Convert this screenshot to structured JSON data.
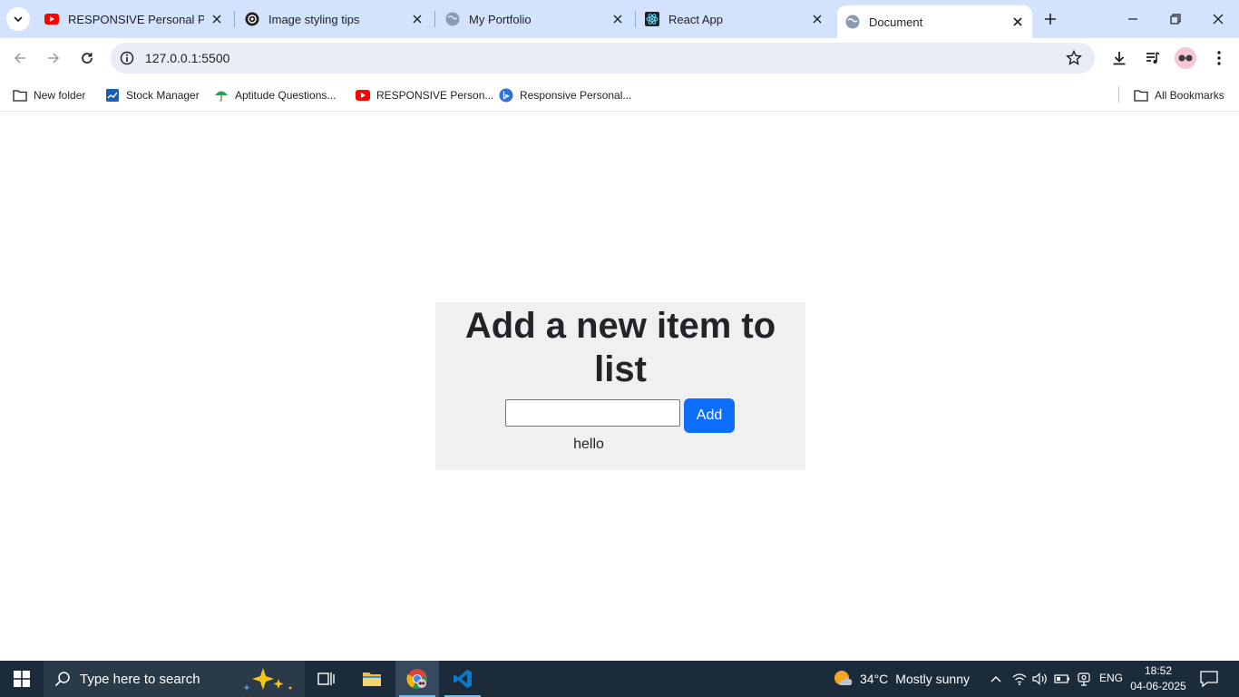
{
  "browser": {
    "tabs": [
      {
        "title": "RESPONSIVE Personal PORT",
        "favicon": "youtube-icon",
        "active": false
      },
      {
        "title": "Image styling tips",
        "favicon": "openai-icon",
        "active": false
      },
      {
        "title": "My Portfolio",
        "favicon": "globe-icon",
        "active": false
      },
      {
        "title": "React App",
        "favicon": "react-icon",
        "active": false
      },
      {
        "title": "Document",
        "favicon": "globe-icon",
        "active": true
      }
    ],
    "address": {
      "url": "127.0.0.1:5500"
    },
    "bookmarks": [
      {
        "label": "New folder",
        "icon": "folder-icon"
      },
      {
        "label": "Stock Manager",
        "icon": "chart-icon"
      },
      {
        "label": "Aptitude Questions...",
        "icon": "umbrella-icon"
      },
      {
        "label": "RESPONSIVE Person...",
        "icon": "youtube-icon"
      },
      {
        "label": "Responsive Personal...",
        "icon": "bing-icon"
      }
    ],
    "all_bookmarks": "All Bookmarks"
  },
  "page": {
    "heading": "Add a new item to list",
    "input_value": "",
    "add_button": "Add",
    "items": [
      "hello"
    ]
  },
  "taskbar": {
    "search_placeholder": "Type here to search",
    "weather": {
      "temp": "34°C",
      "condition": "Mostly sunny"
    },
    "language": "ENG",
    "time": "18:52",
    "date": "04-06-2025"
  },
  "colors": {
    "tabstrip": "#d3e3fd",
    "accent": "#0d6efd",
    "card": "#f0f0f0",
    "taskbar": "#1c2b3a"
  }
}
